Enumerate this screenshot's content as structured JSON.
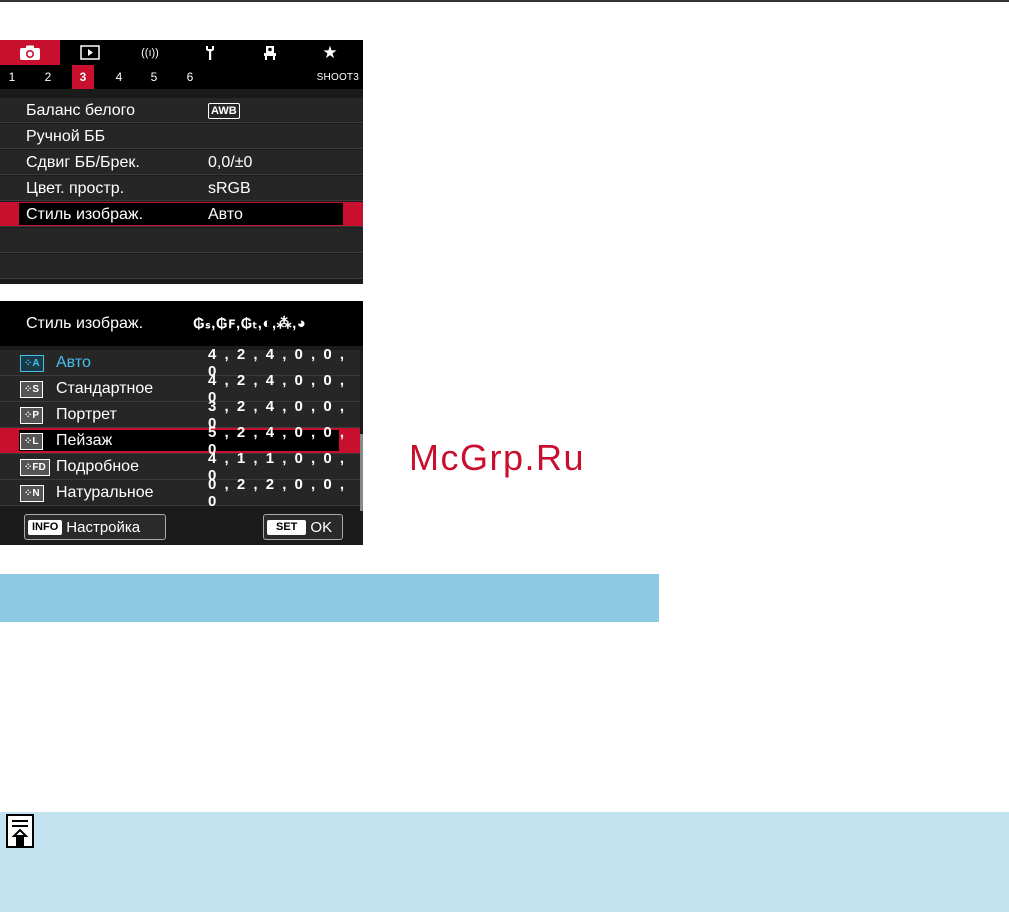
{
  "shoot_menu": {
    "tabs": [
      {
        "icon": "camera-icon",
        "active": true
      },
      {
        "icon": "playback-icon",
        "active": false
      },
      {
        "icon": "wireless-icon",
        "active": false
      },
      {
        "icon": "wrench-icon",
        "active": false
      },
      {
        "icon": "custom-functions-icon",
        "active": false
      },
      {
        "icon": "star-icon",
        "active": false
      }
    ],
    "pages": [
      "1",
      "2",
      "3",
      "4",
      "5",
      "6"
    ],
    "active_page": "3",
    "page_code": "SHOOT3",
    "items": [
      {
        "label": "Баланс белого",
        "value": "AWB"
      },
      {
        "label": "Ручной ББ",
        "value": ""
      },
      {
        "label": "Сдвиг ББ/Брек.",
        "value": "0,0/±0"
      },
      {
        "label": "Цвет. простр.",
        "value": "sRGB"
      },
      {
        "label": "Стиль изображ.",
        "value": "Авто",
        "selected": true
      }
    ]
  },
  "picture_style": {
    "title": "Стиль изображ.",
    "params_header": "₲ₛ,₲ꜰ,₲ₜ,◐,⁂,◕",
    "rows": [
      {
        "badge": "⁘A",
        "name": "Авто",
        "values": "4 , 2 , 4 , 0 , 0 , 0",
        "highlight": "blue"
      },
      {
        "badge": "⁘S",
        "name": "Стандартное",
        "values": "4 , 2 , 4 , 0 , 0 , 0"
      },
      {
        "badge": "⁘P",
        "name": "Портрет",
        "values": "3 , 2 , 4 , 0 , 0 , 0"
      },
      {
        "badge": "⁘L",
        "name": "Пейзаж",
        "values": "5 , 2 , 4 , 0 , 0 , 0",
        "selected": true
      },
      {
        "badge": "⁘FD",
        "name": "Подробное",
        "values": "4 , 1 , 1 , 0 , 0 , 0"
      },
      {
        "badge": "⁘N",
        "name": "Натуральное",
        "values": "0 , 2 , 2 , 0 , 0 , 0"
      }
    ],
    "info_key": "INFO",
    "info_label": "Настройка",
    "set_key": "SET",
    "set_label": "OK"
  },
  "watermark": "McGrp.Ru",
  "colors": {
    "canon_red": "#c8102e",
    "band_blue": "#8dc9e2",
    "note_blue": "#c2e3ef",
    "auto_blue": "#44bfee"
  }
}
